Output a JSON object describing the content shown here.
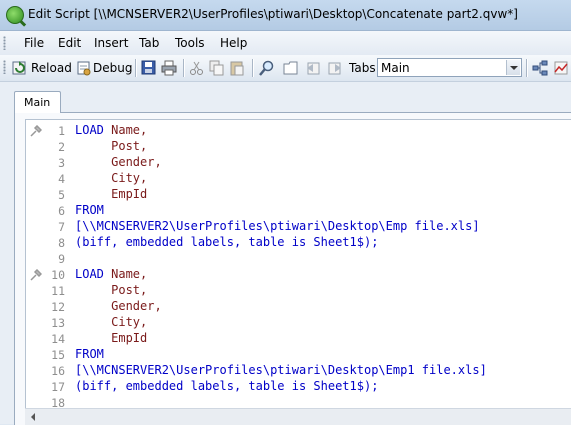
{
  "window": {
    "title": "Edit Script [\\\\MCNSERVER2\\UserProfiles\\ptiwari\\Desktop\\Concatenate part2.qvw*]"
  },
  "menu": [
    "File",
    "Edit",
    "Insert",
    "Tab",
    "Tools",
    "Help"
  ],
  "toolbar": {
    "reload_label": "Reload",
    "debug_label": "Debug",
    "tabs_label": "Tabs",
    "tab_select_value": "Main"
  },
  "tabs": [
    {
      "label": "Main",
      "active": true
    }
  ],
  "editor": {
    "lines": [
      {
        "num": "1",
        "kw": "LOAD",
        "text": " Name,",
        "pin": true
      },
      {
        "num": "2",
        "kw": "",
        "text": "     Post,"
      },
      {
        "num": "3",
        "kw": "",
        "text": "     Gender,"
      },
      {
        "num": "4",
        "kw": "",
        "text": "     City,"
      },
      {
        "num": "5",
        "kw": "",
        "text": "     EmpId"
      },
      {
        "num": "6",
        "kw": "FROM",
        "text": ""
      },
      {
        "num": "7",
        "kw": "",
        "text": "[\\\\MCNSERVER2\\UserProfiles\\ptiwari\\Desktop\\Emp file.xls]",
        "blue": true
      },
      {
        "num": "8",
        "kw": "",
        "text": "(biff, embedded labels, table is Sheet1$);",
        "blue": true
      },
      {
        "num": "9",
        "kw": "",
        "text": ""
      },
      {
        "num": "10",
        "kw": "LOAD",
        "text": " Name,",
        "pin": true
      },
      {
        "num": "11",
        "kw": "",
        "text": "     Post,"
      },
      {
        "num": "12",
        "kw": "",
        "text": "     Gender,"
      },
      {
        "num": "13",
        "kw": "",
        "text": "     City,"
      },
      {
        "num": "14",
        "kw": "",
        "text": "     EmpId"
      },
      {
        "num": "15",
        "kw": "FROM",
        "text": ""
      },
      {
        "num": "16",
        "kw": "",
        "text": "[\\\\MCNSERVER2\\UserProfiles\\ptiwari\\Desktop\\Emp1 file.xls]",
        "blue": true
      },
      {
        "num": "17",
        "kw": "",
        "text": "(biff, embedded labels, table is Sheet1$);",
        "blue": true
      },
      {
        "num": "18",
        "kw": "",
        "text": ""
      }
    ]
  },
  "icons": [
    "app-icon",
    "reload-icon",
    "debug-icon",
    "save-icon",
    "print-icon",
    "cut-icon",
    "copy-icon",
    "paste-icon",
    "find-icon",
    "folder-icon",
    "tab-left-icon",
    "tab-right-icon",
    "network-icon",
    "chart-icon",
    "pin-icon"
  ],
  "colors": {
    "keyword": "#0000c8",
    "text": "#7a1a1a",
    "line_number": "#8e8e8e"
  }
}
